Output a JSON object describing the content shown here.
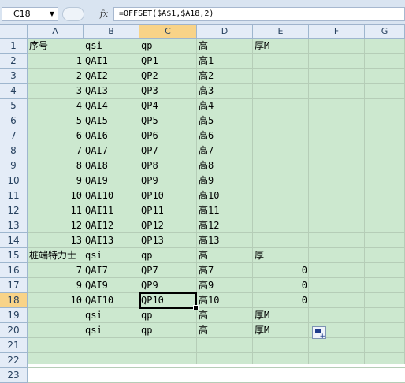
{
  "name_box": {
    "value": "C18"
  },
  "formula_bar": {
    "fx_label": "fx",
    "formula": "=OFFSET($A$1,$A18,2)"
  },
  "columns": [
    "A",
    "B",
    "C",
    "D",
    "E",
    "F",
    "G"
  ],
  "selected_column": "C",
  "selected_row": 18,
  "rows": [
    {
      "n": "1",
      "A": "序号",
      "B": "qsi",
      "C": "qp",
      "D": "高",
      "E": "厚M"
    },
    {
      "n": "2",
      "A": "1",
      "B": "QAI1",
      "C": "QP1",
      "D": "高1",
      "E": ""
    },
    {
      "n": "3",
      "A": "2",
      "B": "QAI2",
      "C": "QP2",
      "D": "高2",
      "E": ""
    },
    {
      "n": "4",
      "A": "3",
      "B": "QAI3",
      "C": "QP3",
      "D": "高3",
      "E": ""
    },
    {
      "n": "5",
      "A": "4",
      "B": "QAI4",
      "C": "QP4",
      "D": "高4",
      "E": ""
    },
    {
      "n": "6",
      "A": "5",
      "B": "QAI5",
      "C": "QP5",
      "D": "高5",
      "E": ""
    },
    {
      "n": "7",
      "A": "6",
      "B": "QAI6",
      "C": "QP6",
      "D": "高6",
      "E": ""
    },
    {
      "n": "8",
      "A": "7",
      "B": "QAI7",
      "C": "QP7",
      "D": "高7",
      "E": ""
    },
    {
      "n": "9",
      "A": "8",
      "B": "QAI8",
      "C": "QP8",
      "D": "高8",
      "E": ""
    },
    {
      "n": "10",
      "A": "9",
      "B": "QAI9",
      "C": "QP9",
      "D": "高9",
      "E": ""
    },
    {
      "n": "11",
      "A": "10",
      "B": "QAI10",
      "C": "QP10",
      "D": "高10",
      "E": ""
    },
    {
      "n": "12",
      "A": "11",
      "B": "QAI11",
      "C": "QP11",
      "D": "高11",
      "E": ""
    },
    {
      "n": "13",
      "A": "12",
      "B": "QAI12",
      "C": "QP12",
      "D": "高12",
      "E": ""
    },
    {
      "n": "14",
      "A": "13",
      "B": "QAI13",
      "C": "QP13",
      "D": "高13",
      "E": ""
    },
    {
      "n": "15",
      "A": "桩端特力士",
      "B": "qsi",
      "C": "qp",
      "D": "高",
      "E": "厚"
    },
    {
      "n": "16",
      "A": "7",
      "B": "QAI7",
      "C": "QP7",
      "D": "高7",
      "E": "0"
    },
    {
      "n": "17",
      "A": "9",
      "B": "QAI9",
      "C": "QP9",
      "D": "高9",
      "E": "0"
    },
    {
      "n": "18",
      "A": "10",
      "B": "QAI10",
      "C": "QP10",
      "D": "高10",
      "E": "0"
    },
    {
      "n": "19",
      "A": "",
      "B": "qsi",
      "C": "qp",
      "D": "高",
      "E": "厚M"
    },
    {
      "n": "20",
      "A": "",
      "B": "qsi",
      "C": "qp",
      "D": "高",
      "E": "厚M"
    },
    {
      "n": "21",
      "A": "",
      "B": "",
      "C": "",
      "D": "",
      "E": ""
    },
    {
      "n": "22",
      "A": "",
      "B": "",
      "C": "",
      "D": "",
      "E": ""
    },
    {
      "n": "23",
      "A": "",
      "B": "",
      "C": "",
      "D": "",
      "E": ""
    }
  ],
  "paste_options_icon": "paste-options-icon"
}
